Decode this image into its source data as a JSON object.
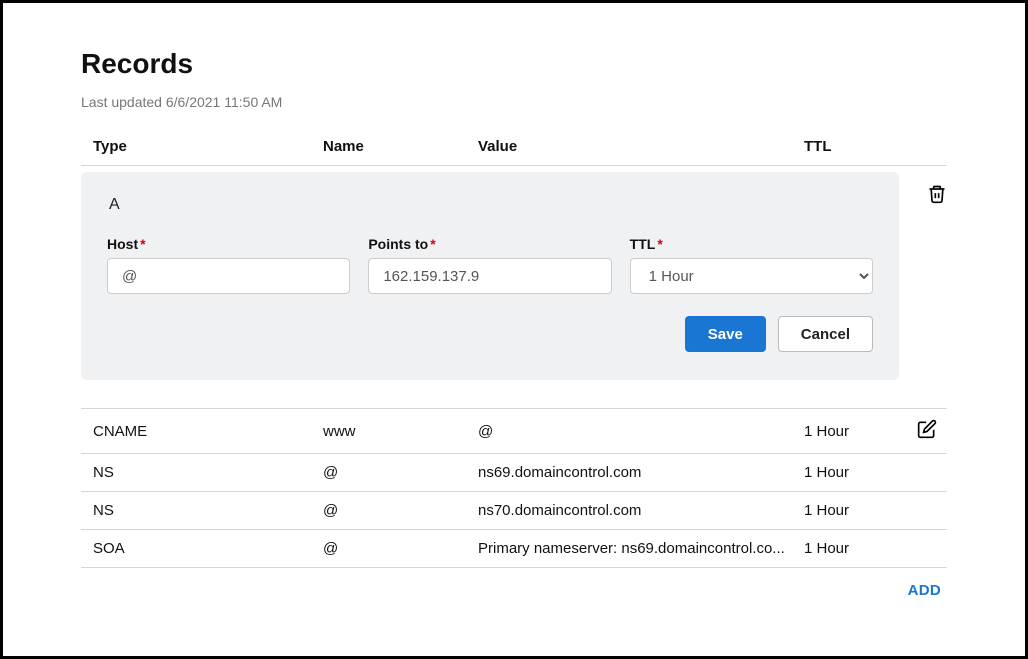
{
  "pageTitle": "Records",
  "lastUpdated": "Last updated 6/6/2021 11:50 AM",
  "headers": {
    "type": "Type",
    "name": "Name",
    "value": "Value",
    "ttl": "TTL"
  },
  "editPanel": {
    "recordType": "A",
    "labels": {
      "host": "Host",
      "pointsTo": "Points to",
      "ttl": "TTL"
    },
    "values": {
      "host": "@",
      "pointsTo": "162.159.137.9",
      "ttl": "1 Hour"
    },
    "buttons": {
      "save": "Save",
      "cancel": "Cancel"
    }
  },
  "records": [
    {
      "type": "CNAME",
      "name": "www",
      "value": "@",
      "ttl": "1 Hour",
      "editable": true
    },
    {
      "type": "NS",
      "name": "@",
      "value": "ns69.domaincontrol.com",
      "ttl": "1 Hour",
      "editable": false
    },
    {
      "type": "NS",
      "name": "@",
      "value": "ns70.domaincontrol.com",
      "ttl": "1 Hour",
      "editable": false
    },
    {
      "type": "SOA",
      "name": "@",
      "value": "Primary nameserver: ns69.domaincontrol.co...",
      "ttl": "1 Hour",
      "editable": false
    }
  ],
  "addButton": "ADD"
}
